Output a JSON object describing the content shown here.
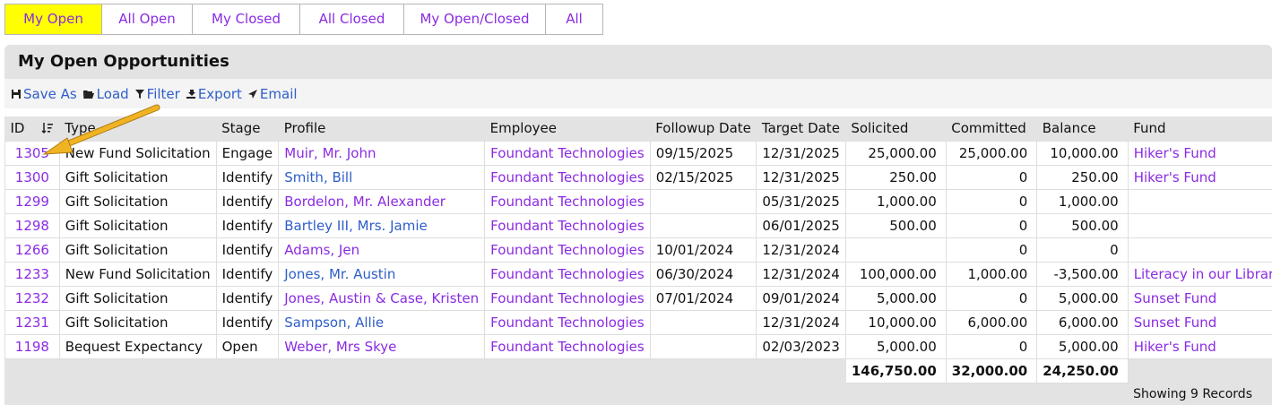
{
  "tabs": [
    {
      "label": "My Open",
      "active": true
    },
    {
      "label": "All Open",
      "active": false
    },
    {
      "label": "My Closed",
      "active": false
    },
    {
      "label": "All Closed",
      "active": false
    },
    {
      "label": "My Open/Closed",
      "active": false
    },
    {
      "label": "All",
      "active": false
    }
  ],
  "panel": {
    "title": "My Open Opportunities"
  },
  "toolbar": {
    "save_as": "Save As",
    "load": "Load",
    "filter": "Filter",
    "export": "Export",
    "email": "Email"
  },
  "table": {
    "headers": [
      "ID",
      "Type",
      "Stage",
      "Profile",
      "Employee",
      "Followup Date",
      "Target Date",
      "Solicited",
      "Committed",
      "Balance",
      "Fund"
    ],
    "rows": [
      {
        "id": "1305",
        "type": "New Fund Solicitation",
        "stage": "Engage",
        "profile": "Muir, Mr. John",
        "employee": "Foundant Technologies",
        "followup": "09/15/2025",
        "target": "12/31/2025",
        "solicited": "25,000.00",
        "committed": "25,000.00",
        "balance": "10,000.00",
        "fund": "Hiker's Fund"
      },
      {
        "id": "1300",
        "type": "Gift Solicitation",
        "stage": "Identify",
        "profile": "Smith, Bill",
        "employee": "Foundant Technologies",
        "followup": "02/15/2025",
        "target": "12/31/2025",
        "solicited": "250.00",
        "committed": "0",
        "balance": "250.00",
        "fund": "Hiker's Fund"
      },
      {
        "id": "1299",
        "type": "Gift Solicitation",
        "stage": "Identify",
        "profile": "Bordelon, Mr. Alexander",
        "employee": "Foundant Technologies",
        "followup": "",
        "target": "05/31/2025",
        "solicited": "1,000.00",
        "committed": "0",
        "balance": "1,000.00",
        "fund": ""
      },
      {
        "id": "1298",
        "type": "Gift Solicitation",
        "stage": "Identify",
        "profile": "Bartley III, Mrs. Jamie",
        "employee": "Foundant Technologies",
        "followup": "",
        "target": "06/01/2025",
        "solicited": "500.00",
        "committed": "0",
        "balance": "500.00",
        "fund": ""
      },
      {
        "id": "1266",
        "type": "Gift Solicitation",
        "stage": "Identify",
        "profile": "Adams, Jen",
        "employee": "Foundant Technologies",
        "followup": "10/01/2024",
        "target": "12/31/2024",
        "solicited": "",
        "committed": "0",
        "balance": "0",
        "fund": ""
      },
      {
        "id": "1233",
        "type": "New Fund Solicitation",
        "stage": "Identify",
        "profile": "Jones, Mr. Austin",
        "employee": "Foundant Technologies",
        "followup": "06/30/2024",
        "target": "12/31/2024",
        "solicited": "100,000.00",
        "committed": "1,000.00",
        "balance": "-3,500.00",
        "fund": "Literacy in our Libraries"
      },
      {
        "id": "1232",
        "type": "Gift Solicitation",
        "stage": "Identify",
        "profile": "Jones, Austin & Case, Kristen",
        "employee": "Foundant Technologies",
        "followup": "07/01/2024",
        "target": "09/01/2024",
        "solicited": "5,000.00",
        "committed": "0",
        "balance": "5,000.00",
        "fund": "Sunset Fund"
      },
      {
        "id": "1231",
        "type": "Gift Solicitation",
        "stage": "Identify",
        "profile": "Sampson, Allie",
        "employee": "Foundant Technologies",
        "followup": "",
        "target": "12/31/2024",
        "solicited": "10,000.00",
        "committed": "6,000.00",
        "balance": "6,000.00",
        "fund": "Sunset Fund"
      },
      {
        "id": "1198",
        "type": "Bequest Expectancy",
        "stage": "Open",
        "profile": "Weber, Mrs Skye",
        "employee": "Foundant Technologies",
        "followup": "",
        "target": "02/03/2023",
        "solicited": "5,000.00",
        "committed": "0",
        "balance": "5,000.00",
        "fund": "Hiker's Fund"
      }
    ],
    "totals": {
      "solicited": "146,750.00",
      "committed": "32,000.00",
      "balance": "24,250.00"
    }
  },
  "footer": {
    "records": "Showing 9 Records"
  },
  "colors": {
    "active_tab": "#ffff00",
    "link_purple": "#8a2be2",
    "link_blue": "#2e5ec8",
    "panel_bg": "#e3e3e3",
    "arrow": "#f0b323"
  }
}
